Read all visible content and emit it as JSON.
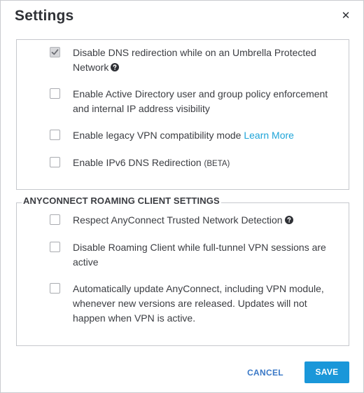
{
  "dialog": {
    "title": "Settings",
    "close_icon": "close-icon"
  },
  "general": {
    "options": [
      {
        "label": "Disable DNS redirection while on an Umbrella Protected",
        "label_line2": "Network",
        "checked": true,
        "help_icon": "question-circle-icon"
      },
      {
        "label": "Enable Active Directory user and group policy enforcement",
        "label_line2": "and internal IP address visibility",
        "checked": false
      },
      {
        "label": "Enable legacy VPN compatibility mode",
        "link": "Learn More",
        "checked": false
      },
      {
        "label": "Enable IPv6 DNS Redirection",
        "suffix": "(BETA)",
        "checked": false
      }
    ]
  },
  "anyconnect": {
    "heading": "ANYCONNECT ROAMING CLIENT SETTINGS",
    "options": [
      {
        "label": "Respect AnyConnect Trusted Network Detection",
        "checked": false,
        "help_icon": "question-circle-icon"
      },
      {
        "label": "Disable Roaming Client while full-tunnel VPN sessions are",
        "label_line2": "active",
        "checked": false
      },
      {
        "label": "Automatically update AnyConnect, including VPN module,",
        "label_line2": "whenever new versions are released. Updates will not",
        "label_line3": "happen when VPN is active.",
        "checked": false
      }
    ]
  },
  "footer": {
    "cancel_label": "CANCEL",
    "save_label": "SAVE"
  },
  "colors": {
    "accent": "#1a97d9",
    "link": "#1ea4d8",
    "cancel_text": "#3b79c7"
  }
}
